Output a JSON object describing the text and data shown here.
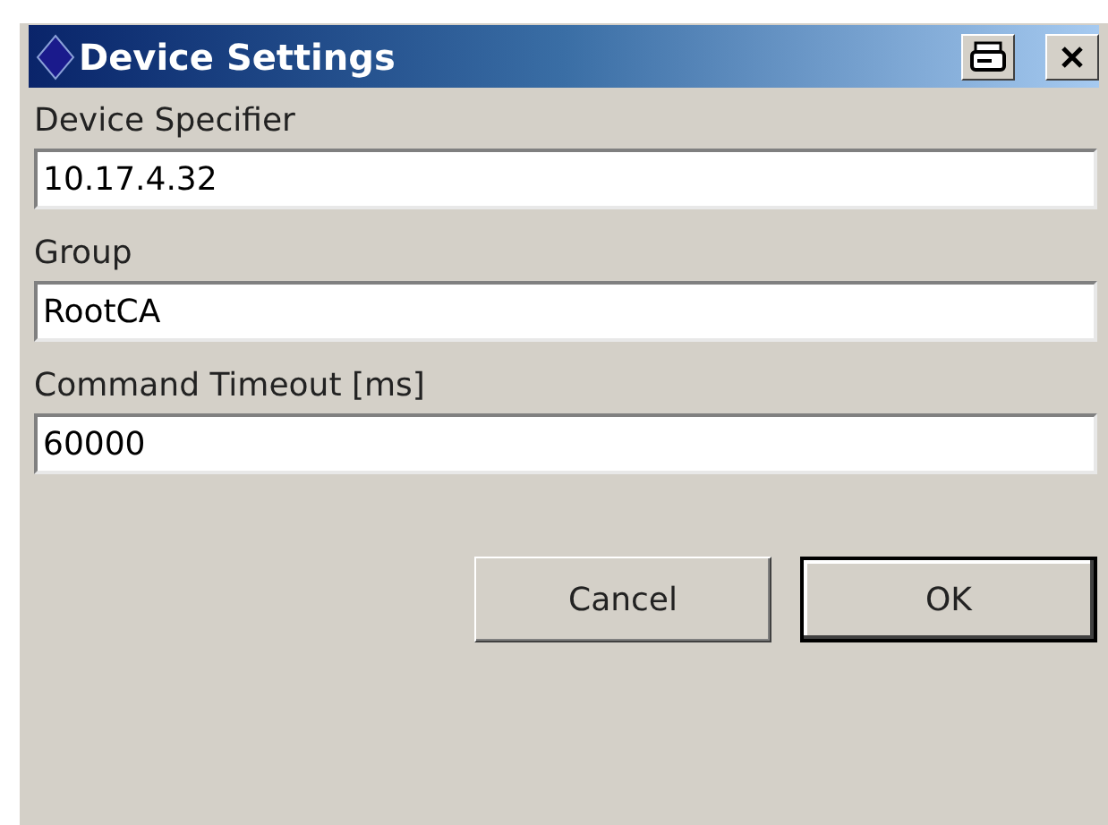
{
  "window": {
    "title": "Device Settings"
  },
  "fields": [
    {
      "label": "Device Specifier",
      "value": "10.17.4.32"
    },
    {
      "label": "Group",
      "value": "RootCA"
    },
    {
      "label": "Command Timeout [ms]",
      "value": "60000"
    }
  ],
  "buttons": [
    {
      "label": "Cancel",
      "default": false
    },
    {
      "label": "OK",
      "default": true
    }
  ]
}
